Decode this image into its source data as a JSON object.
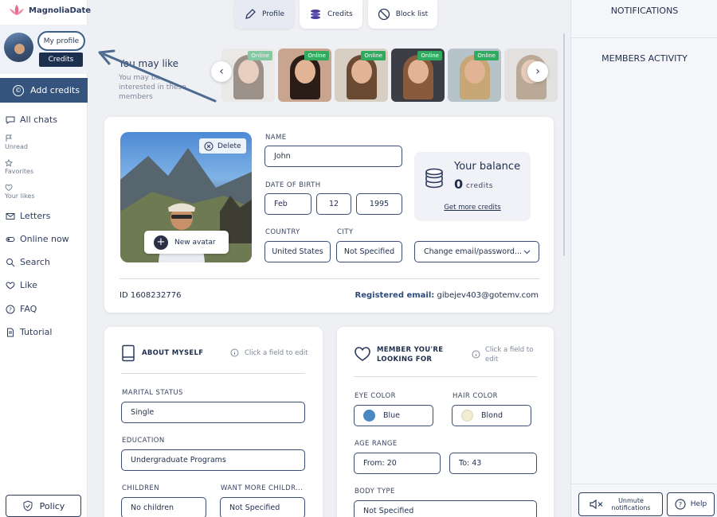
{
  "app": {
    "name": "MagnoliaDate"
  },
  "sidebar": {
    "my_profile": "My profile",
    "credits": "Credits",
    "add_credits": "Add credits",
    "items": [
      {
        "label": "All chats",
        "icon": "chat-icon"
      },
      {
        "label": "Unread",
        "icon": "flag-icon"
      },
      {
        "label": "Favorites",
        "icon": "star-icon"
      },
      {
        "label": "Your likes",
        "icon": "heart-icon"
      },
      {
        "label": "Letters",
        "icon": "envelope-icon"
      },
      {
        "label": "Online now",
        "icon": "toggle-icon"
      },
      {
        "label": "Search",
        "icon": "search-icon"
      },
      {
        "label": "Like",
        "icon": "like-icon"
      },
      {
        "label": "FAQ",
        "icon": "question-icon"
      },
      {
        "label": "Tutorial",
        "icon": "document-icon"
      }
    ],
    "policy": "Policy"
  },
  "tabs": [
    {
      "label": "Profile",
      "icon": "pencil-icon",
      "active": true
    },
    {
      "label": "Credits",
      "icon": "coins-icon",
      "active": false
    },
    {
      "label": "Block list",
      "icon": "block-icon",
      "active": false
    }
  ],
  "may_like": {
    "title": "You may like",
    "subtitle": "You may be interested in these members",
    "online_label": "Online",
    "members_count_visible": 6
  },
  "profile": {
    "delete": "Delete",
    "new_avatar": "New avatar",
    "name_label": "NAME",
    "name": "John",
    "dob_label": "DATE OF BIRTH",
    "dob_month": "Feb",
    "dob_day": "12",
    "dob_year": "1995",
    "country_label": "COUNTRY",
    "country": "United States",
    "city_label": "CITY",
    "city": "Not Specified",
    "balance_title": "Your balance",
    "balance_value": "0",
    "balance_unit": "credits",
    "get_more": "Get more credits",
    "change_email": "Change email/password...",
    "id_text": "ID 1608232776",
    "registered_label": "Registered email:",
    "registered_email": "gibejev403@gotemv.com"
  },
  "about": {
    "title": "ABOUT MYSELF",
    "hint": "Click a field to edit",
    "marital_label": "MARITAL STATUS",
    "marital": "Single",
    "education_label": "EDUCATION",
    "education": "Undergraduate Programs",
    "children_label": "CHILDREN",
    "children": "No children",
    "want_more_label": "WANT MORE CHILDR...",
    "want_more": "Not Specified"
  },
  "looking": {
    "title": "MEMBER YOU'RE LOOKING FOR",
    "hint": "Click a field to edit",
    "eye_label": "EYE COLOR",
    "eye": "Blue",
    "eye_color": "#4a86c3",
    "hair_label": "HAIR COLOR",
    "hair": "Blond",
    "hair_color": "#f2ecd2",
    "age_label": "AGE RANGE",
    "age_from": "From: 20",
    "age_to": "To: 43",
    "body_label": "BODY TYPE",
    "body": "Not Specified"
  },
  "right": {
    "notifications": "NOTIFICATIONS",
    "members_activity": "MEMBERS ACTIVITY",
    "unmute": "Unmute notifications",
    "help": "Help"
  },
  "colors": {
    "primary": "#34537d",
    "online": "#2faa5e",
    "dark": "#1d2f4f"
  }
}
